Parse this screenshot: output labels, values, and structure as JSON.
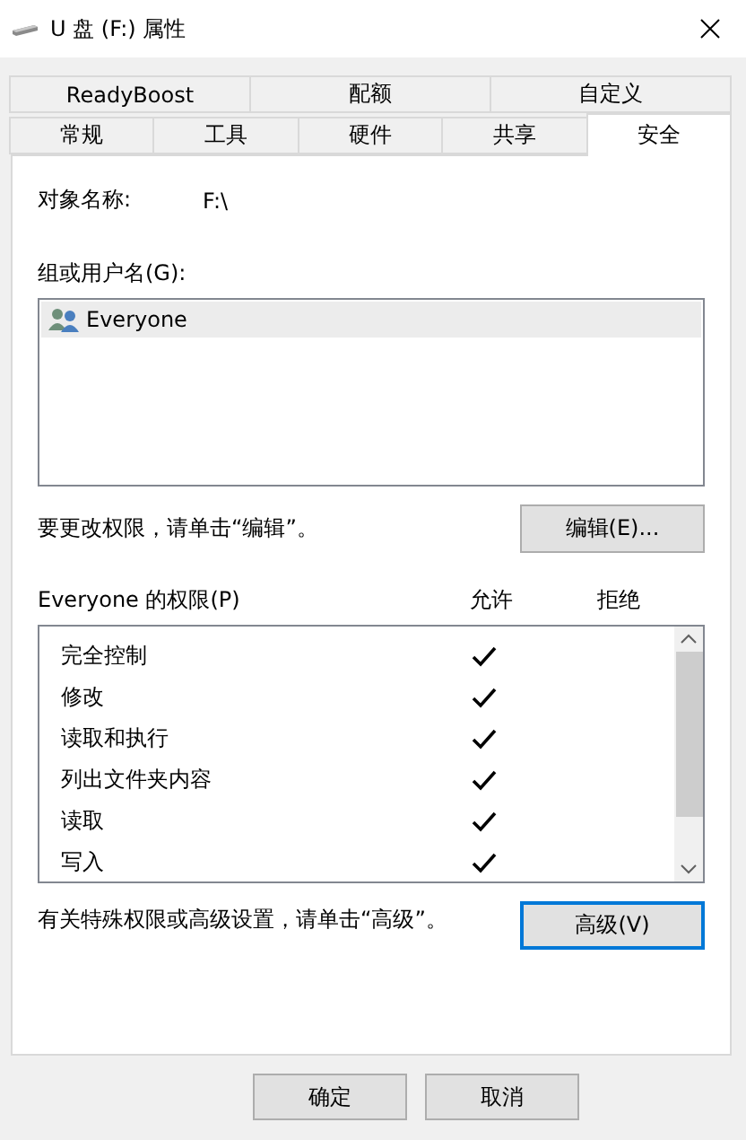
{
  "window": {
    "title": "U 盘 (F:) 属性"
  },
  "tab_rows": [
    [
      {
        "label": "ReadyBoost",
        "selected": false
      },
      {
        "label": "配额",
        "selected": false
      },
      {
        "label": "自定义",
        "selected": false
      }
    ],
    [
      {
        "label": "常规",
        "selected": false
      },
      {
        "label": "工具",
        "selected": false
      },
      {
        "label": "硬件",
        "selected": false
      },
      {
        "label": "共享",
        "selected": false
      },
      {
        "label": "安全",
        "selected": true
      }
    ]
  ],
  "object_name": {
    "label": "对象名称:",
    "value": "F:\\"
  },
  "users": {
    "label": "组或用户名(G):",
    "items": [
      {
        "name": "Everyone",
        "selected": true
      }
    ]
  },
  "edit_hint": "要更改权限，请单击“编辑”。",
  "edit_button": "编辑(E)...",
  "permissions": {
    "label": "Everyone 的权限(P)",
    "allow_header": "允许",
    "deny_header": "拒绝",
    "rows": [
      {
        "name": "完全控制",
        "allow": true,
        "deny": false
      },
      {
        "name": "修改",
        "allow": true,
        "deny": false
      },
      {
        "name": "读取和执行",
        "allow": true,
        "deny": false
      },
      {
        "name": "列出文件夹内容",
        "allow": true,
        "deny": false
      },
      {
        "name": "读取",
        "allow": true,
        "deny": false
      },
      {
        "name": "写入",
        "allow": true,
        "deny": false
      }
    ]
  },
  "advanced_hint": "有关特殊权限或高级设置，请单击“高级”。",
  "advanced_button": "高级(V)",
  "buttons": [
    "确定",
    "取消"
  ]
}
